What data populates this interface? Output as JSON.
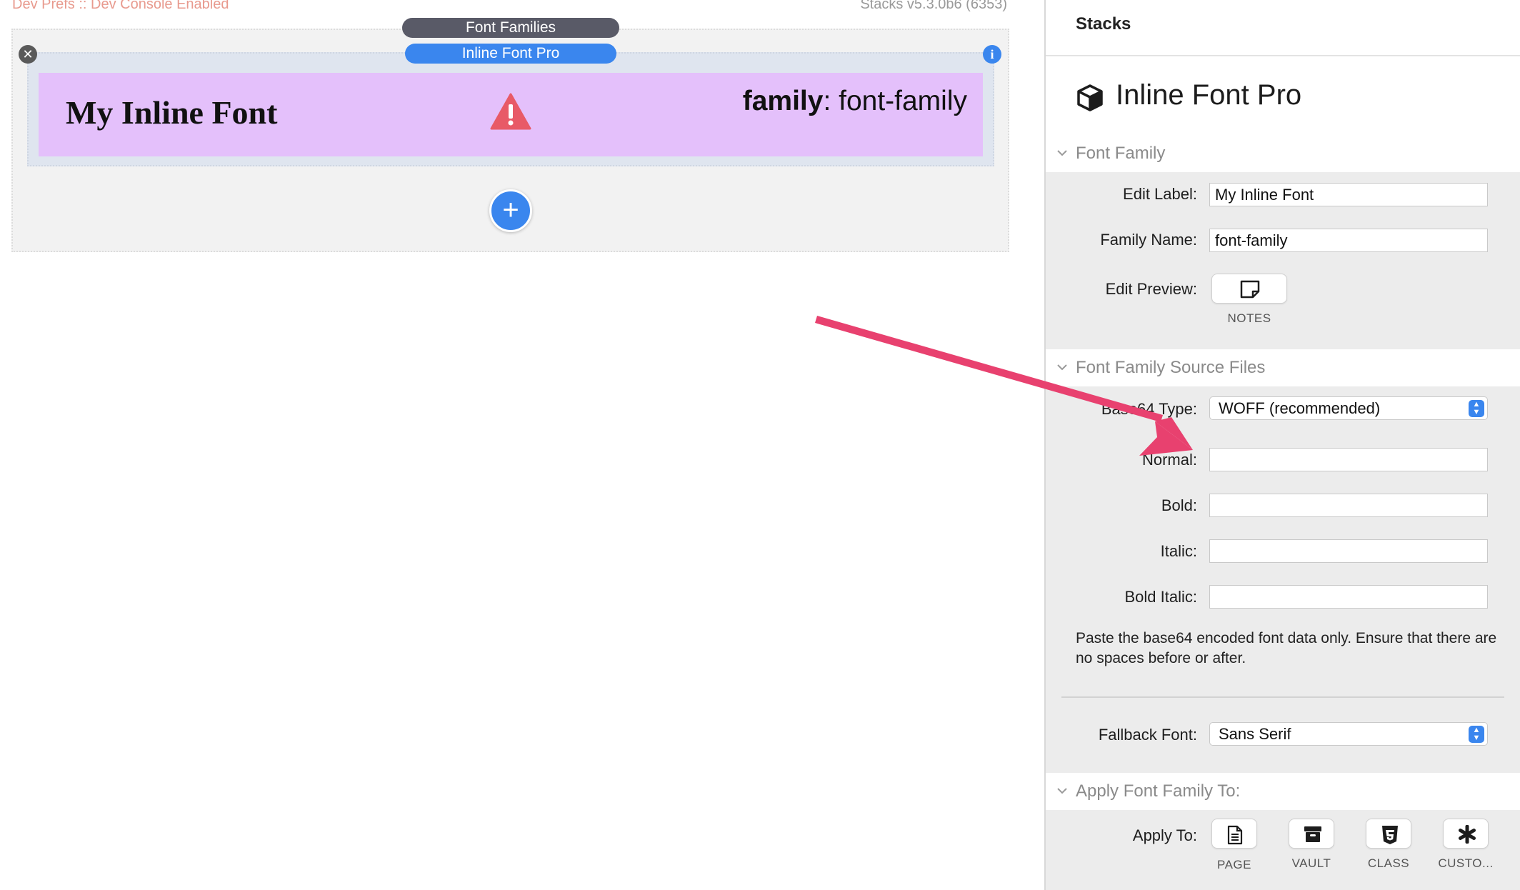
{
  "canvas": {
    "dev_prefs": "Dev Prefs :: Dev Console Enabled",
    "version": "Stacks v5.3.0b6 (6353)",
    "parent_stack_label": "Font Families",
    "selected_stack_label": "Inline Font Pro",
    "preview_title": "My Inline Font",
    "preview_family_key": "family",
    "preview_family_value": ": font-family",
    "add_symbol": "+",
    "close_symbol": "✕",
    "info_symbol": "i"
  },
  "panel": {
    "header": "Stacks",
    "stack_title": "Inline Font Pro",
    "sections": {
      "font_family": "Font Family",
      "source_files": "Font Family Source Files",
      "apply": "Apply Font Family To:"
    },
    "font_family": {
      "edit_label_label": "Edit Label:",
      "edit_label_value": "My Inline Font",
      "family_name_label": "Family Name:",
      "family_name_value": "font-family",
      "edit_preview_label": "Edit Preview:",
      "notes_caption": "NOTES"
    },
    "source_files": {
      "base64_type_label": "Base64 Type:",
      "base64_type_value": "WOFF (recommended)",
      "normal_label": "Normal:",
      "normal_value": "",
      "bold_label": "Bold:",
      "bold_value": "",
      "italic_label": "Italic:",
      "italic_value": "",
      "bold_italic_label": "Bold Italic:",
      "bold_italic_value": "",
      "help_text": "Paste the base64 encoded font data only. Ensure that there are no spaces before or after.",
      "fallback_label": "Fallback Font:",
      "fallback_value": "Sans Serif"
    },
    "apply": {
      "apply_to_label": "Apply To:",
      "options": [
        {
          "label": "PAGE",
          "icon": "page-icon"
        },
        {
          "label": "VAULT",
          "icon": "vault-icon"
        },
        {
          "label": "CLASS",
          "icon": "css-icon"
        },
        {
          "label": "CUSTO...",
          "icon": "asterisk-icon"
        }
      ]
    }
  },
  "colors": {
    "accent": "#3a86ee",
    "preview_bg": "#e4c0fb",
    "warning": "#e85a67",
    "arrow": "#e8416f"
  }
}
